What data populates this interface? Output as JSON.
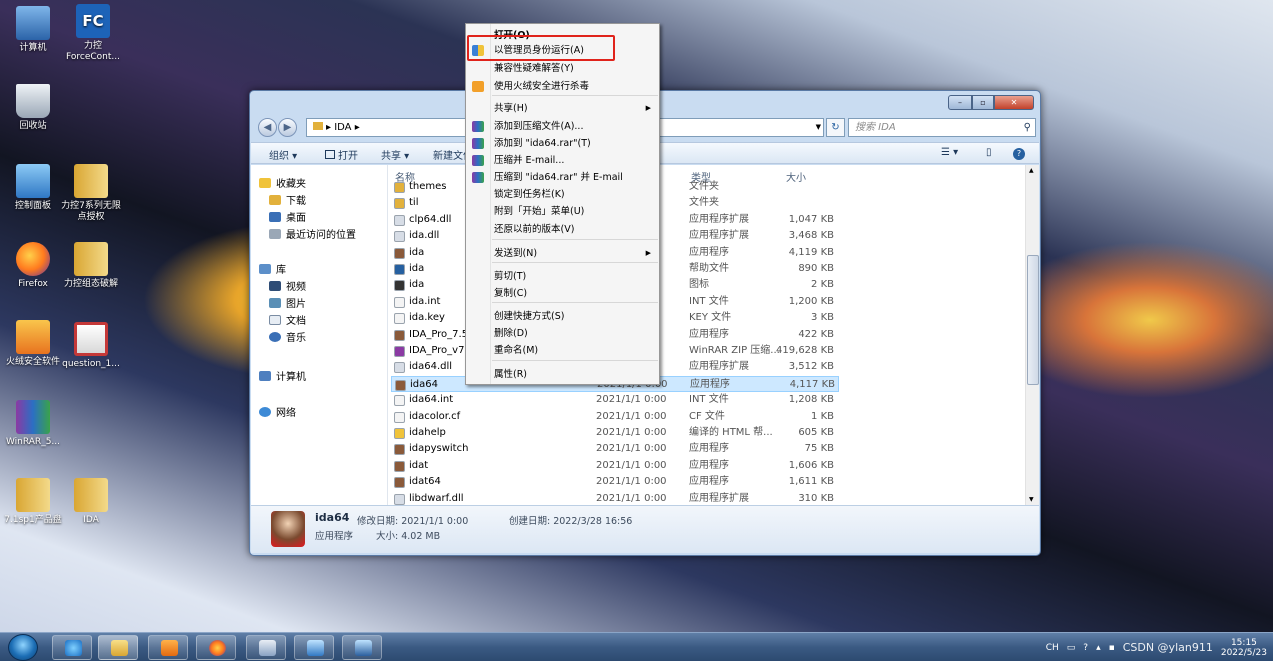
{
  "desktop": {
    "icons": [
      {
        "label": "计算机",
        "color": "#3c7fc4"
      },
      {
        "label": "力控ForceCont...",
        "color": "#1d63b8"
      },
      {
        "label": "回收站",
        "color": "#9aa7b6"
      },
      {
        "label": "控制面板",
        "color": "#3d8ad6"
      },
      {
        "label": "力控7系列无限点授权",
        "color": "#e2b13c"
      },
      {
        "label": "Firefox",
        "color": "#ff7a1e"
      },
      {
        "label": "力控组态破解",
        "color": "#e2b13c"
      },
      {
        "label": "火绒安全软件",
        "color": "#f2a02a"
      },
      {
        "label": "question_1...",
        "color": "#c43838"
      },
      {
        "label": "WinRAR_5...",
        "color": "#8b3aa3"
      },
      {
        "label": "7.1sp1产品盘",
        "color": "#e2b13c"
      },
      {
        "label": "IDA",
        "color": "#e2b13c"
      }
    ]
  },
  "explorer": {
    "address": "▸ IDA ▸",
    "search_placeholder": "搜索 IDA",
    "toolbar": {
      "organize": "组织 ▾",
      "open": "打开",
      "share": "共享 ▾",
      "new_folder": "新建文件"
    },
    "nav": {
      "favorites": "收藏夹",
      "downloads": "下载",
      "desktop": "桌面",
      "recent": "最近访问的位置",
      "libraries": "库",
      "videos": "视频",
      "pictures": "图片",
      "documents": "文档",
      "music": "音乐",
      "computer": "计算机",
      "network": "网络"
    },
    "columns": {
      "name": "名称",
      "type": "类型",
      "size": "大小"
    },
    "files": [
      {
        "name": "themes",
        "date": "5",
        "type": "文件夹",
        "size": ""
      },
      {
        "name": "til",
        "date": "5",
        "type": "文件夹",
        "size": ""
      },
      {
        "name": "clp64.dll",
        "date": "",
        "type": "应用程序扩展",
        "size": "1,047 KB"
      },
      {
        "name": "ida.dll",
        "date": "",
        "type": "应用程序扩展",
        "size": "3,468 KB"
      },
      {
        "name": "ida",
        "date": "",
        "type": "应用程序",
        "size": "4,119 KB"
      },
      {
        "name": "ida",
        "date": "",
        "type": "帮助文件",
        "size": "890 KB"
      },
      {
        "name": "ida",
        "date": "",
        "type": "图标",
        "size": "2 KB"
      },
      {
        "name": "ida.int",
        "date": "",
        "type": "INT 文件",
        "size": "1,200 KB"
      },
      {
        "name": "ida.key",
        "date": "",
        "type": "KEY 文件",
        "size": "3 KB"
      },
      {
        "name": "IDA_Pro_7.5_",
        "date": "",
        "type": "应用程序",
        "size": "422 KB"
      },
      {
        "name": "IDA_Pro_v7.5",
        "date": "0",
        "type": "WinRAR ZIP 压缩...",
        "size": "419,628 KB"
      },
      {
        "name": "ida64.dll",
        "date": "",
        "type": "应用程序扩展",
        "size": "3,512 KB"
      },
      {
        "name": "ida64",
        "date": "2021/1/1 0:00",
        "type": "应用程序",
        "size": "4,117 KB"
      },
      {
        "name": "ida64.int",
        "date": "2021/1/1 0:00",
        "type": "INT 文件",
        "size": "1,208 KB"
      },
      {
        "name": "idacolor.cf",
        "date": "2021/1/1 0:00",
        "type": "CF 文件",
        "size": "1 KB"
      },
      {
        "name": "idahelp",
        "date": "2021/1/1 0:00",
        "type": "编译的 HTML 帮...",
        "size": "605 KB"
      },
      {
        "name": "idapyswitch",
        "date": "2021/1/1 0:00",
        "type": "应用程序",
        "size": "75 KB"
      },
      {
        "name": "idat",
        "date": "2021/1/1 0:00",
        "type": "应用程序",
        "size": "1,606 KB"
      },
      {
        "name": "idat64",
        "date": "2021/1/1 0:00",
        "type": "应用程序",
        "size": "1,611 KB"
      },
      {
        "name": "libdwarf.dll",
        "date": "2021/1/1 0:00",
        "type": "应用程序扩展",
        "size": "310 KB"
      }
    ],
    "details": {
      "name": "ida64",
      "type": "应用程序",
      "modified_label": "修改日期: 2021/1/1 0:00",
      "size_label": "大小: 4.02 MB",
      "created_label": "创建日期: 2022/3/28 16:56"
    }
  },
  "context_menu": {
    "items": [
      {
        "label": "打开(O)",
        "bold": true
      },
      {
        "label": "以管理员身份运行(A)",
        "icon": "shield-icon"
      },
      {
        "label": "兼容性疑难解答(Y)"
      },
      {
        "label": "使用火绒安全进行杀毒",
        "icon": "huorong-icon"
      },
      {
        "label": "共享(H)",
        "submenu": true
      },
      {
        "label": "添加到压缩文件(A)...",
        "icon": "winrar-icon"
      },
      {
        "label": "添加到 \"ida64.rar\"(T)",
        "icon": "winrar-icon"
      },
      {
        "label": "压缩并 E-mail...",
        "icon": "winrar-icon"
      },
      {
        "label": "压缩到 \"ida64.rar\" 并 E-mail",
        "icon": "winrar-icon"
      },
      {
        "label": "锁定到任务栏(K)"
      },
      {
        "label": "附到「开始」菜单(U)"
      },
      {
        "label": "还原以前的版本(V)"
      },
      {
        "label": "发送到(N)",
        "submenu": true
      },
      {
        "label": "剪切(T)"
      },
      {
        "label": "复制(C)"
      },
      {
        "label": "创建快捷方式(S)"
      },
      {
        "label": "删除(D)"
      },
      {
        "label": "重命名(M)"
      },
      {
        "label": "属性(R)"
      }
    ]
  },
  "taskbar": {
    "lang": "CH",
    "watermark": "CSDN @ylan911",
    "time": "15:15",
    "date": "2022/5/23"
  }
}
